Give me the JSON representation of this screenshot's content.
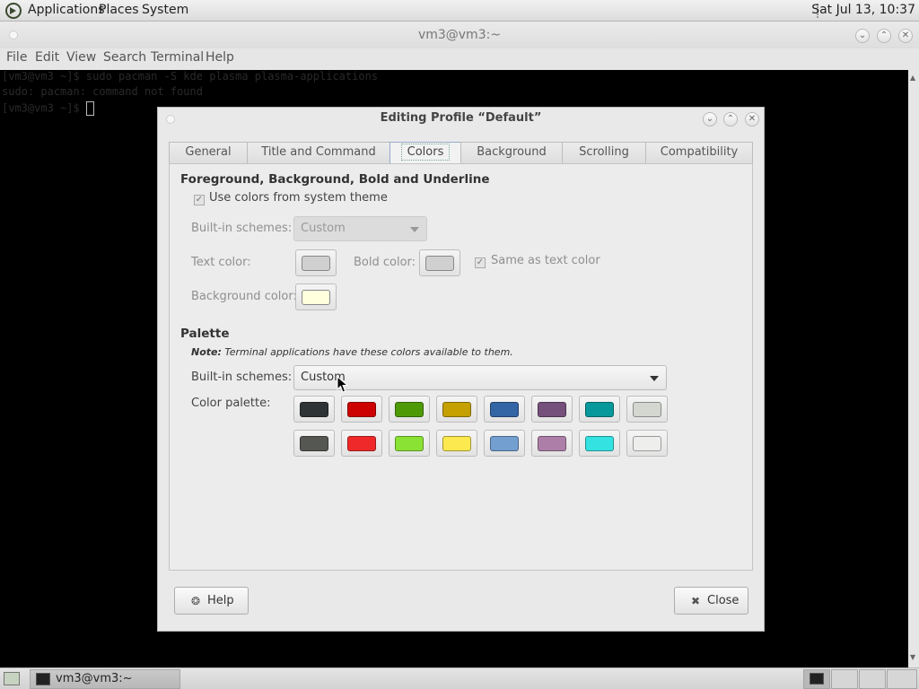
{
  "top_panel": {
    "menus": [
      "Applications",
      "Places",
      "System"
    ],
    "clock": "Sat Jul 13, 10:37"
  },
  "terminal": {
    "title": "vm3@vm3:~",
    "menus": [
      "File",
      "Edit",
      "View",
      "Search",
      "Terminal",
      "Help"
    ],
    "lines": [
      "[vm3@vm3 ~]$ sudo pacman -S kde plasma plasma-applications",
      "sudo: pacman: command not found",
      "[vm3@vm3 ~]$ "
    ]
  },
  "dialog": {
    "title": "Editing Profile “Default”",
    "tabs": [
      "General",
      "Title and Command",
      "Colors",
      "Background",
      "Scrolling",
      "Compatibility"
    ],
    "active_tab": "Colors",
    "fg_section": {
      "heading": "Foreground, Background, Bold and Underline",
      "use_system_colors_label": "Use colors from system theme",
      "use_system_colors_checked": true,
      "builtin_schemes_label": "Built-in schemes:",
      "builtin_schemes_value": "Custom",
      "text_color_label": "Text color:",
      "text_color": "#d0d0d0",
      "bold_color_label": "Bold color:",
      "bold_color": "#d0d0d0",
      "same_as_text_label": "Same as text color",
      "same_as_text_checked": true,
      "background_color_label": "Background color:",
      "background_color": "#ffffdd"
    },
    "palette_section": {
      "heading": "Palette",
      "note_bold": "Note:",
      "note_text": "Terminal applications have these colors available to them.",
      "builtin_schemes_label": "Built-in schemes:",
      "builtin_schemes_value": "Custom",
      "color_palette_label": "Color palette:",
      "colors_row1": [
        "#2e3436",
        "#cc0000",
        "#4e9a06",
        "#c4a000",
        "#3465a4",
        "#75507b",
        "#06989a",
        "#d3d7cf"
      ],
      "colors_row2": [
        "#555753",
        "#ef2929",
        "#8ae234",
        "#fce94f",
        "#729fcf",
        "#ad7fa8",
        "#34e2e2",
        "#eeeeec"
      ]
    },
    "help_label": "Help",
    "close_label": "Close"
  },
  "bottom_panel": {
    "task_label": "vm3@vm3:~"
  }
}
